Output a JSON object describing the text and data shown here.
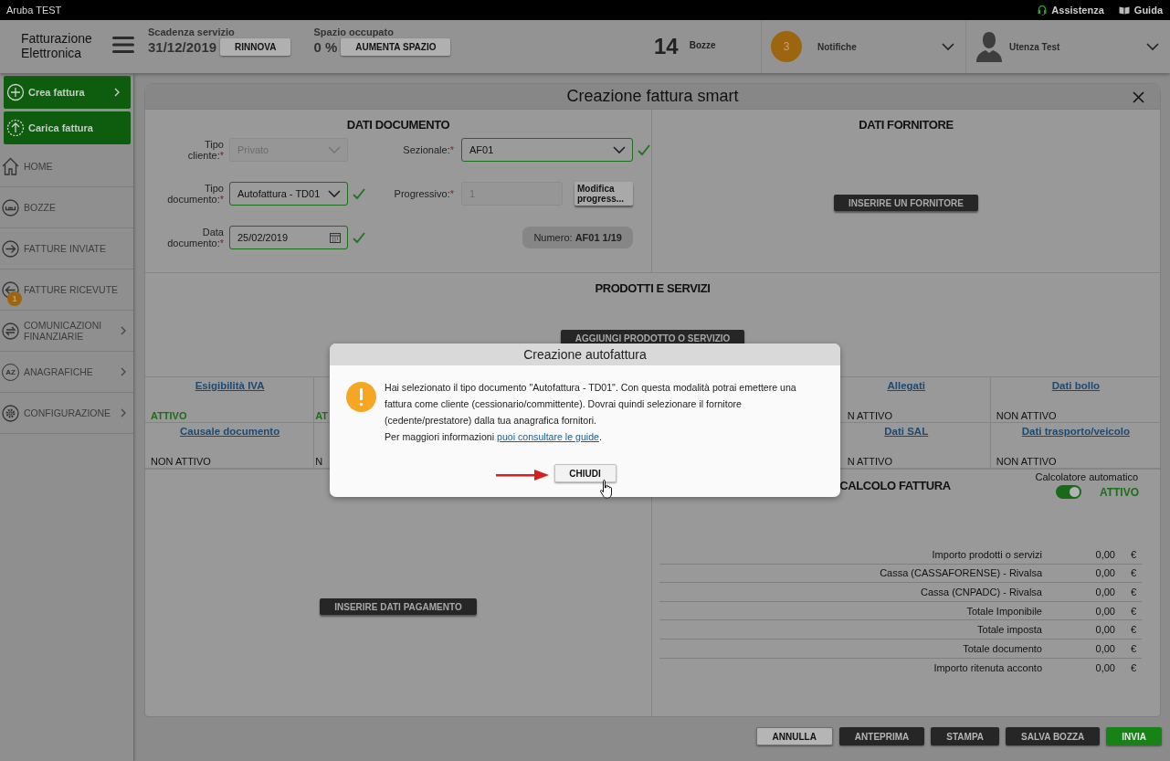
{
  "top_bar": {
    "brand": "Aruba TEST",
    "links": [
      {
        "label": "Assistenza"
      },
      {
        "label": "Guida"
      }
    ]
  },
  "header": {
    "logo": "Fatturazione Elettronica",
    "service_expiry": {
      "label": "Scadenza servizio",
      "value": "31/12/2019",
      "button": "RINNOVA"
    },
    "space": {
      "label": "Spazio occupato",
      "value": "0 %",
      "button": "AUMENTA SPAZIO"
    },
    "drafts": {
      "count": "14",
      "label": "Bozze"
    },
    "notifications": {
      "count": "3",
      "label": "Notifiche"
    },
    "user": {
      "name": "Utenza Test"
    }
  },
  "sidebar": {
    "actions": [
      {
        "label": "Crea fattura",
        "expandable": true
      },
      {
        "label": "Carica fattura",
        "expandable": false
      }
    ],
    "items": [
      {
        "label": "HOME",
        "expandable": false
      },
      {
        "label": "BOZZE",
        "expandable": false
      },
      {
        "label": "FATTURE INVIATE",
        "expandable": false
      },
      {
        "label": "FATTURE RICEVUTE",
        "expandable": false,
        "badge": "1"
      },
      {
        "label": "COMUNICAZIONI FINANZIARIE",
        "expandable": true
      },
      {
        "label": "ANAGRAFICHE",
        "expandable": true,
        "icon_text": "AZ"
      },
      {
        "label": "CONFIGURAZIONE",
        "expandable": true
      }
    ]
  },
  "panel": {
    "title": "Creazione fattura smart",
    "document": {
      "title": "DATI DOCUMENTO",
      "form_rows": [
        {
          "fields": [
            {
              "label": "Tipo cliente:",
              "required_mark": "*",
              "kind": "select",
              "value": "Privato",
              "disabled": true,
              "valid": false
            },
            {
              "label": "Sezionale:",
              "required_mark": "*",
              "kind": "select",
              "value": "AF01",
              "disabled": false,
              "valid": true
            }
          ]
        },
        {
          "fields": [
            {
              "label": "Tipo documento:",
              "required_mark": "*",
              "kind": "select",
              "value": "Autofattura - TD01",
              "disabled": false,
              "valid": true
            },
            {
              "label": "Progressivo:",
              "required_mark": "*",
              "kind": "text",
              "value": "1",
              "disabled": true,
              "valid": false
            }
          ],
          "button": "Modifica progress..."
        },
        {
          "fields": [
            {
              "label": "Data documento:",
              "required_mark": "*",
              "kind": "date",
              "value": "25/02/2019",
              "disabled": false,
              "valid": true
            }
          ],
          "number": {
            "label": "Numero:",
            "value": "AF01 1/19"
          }
        }
      ]
    },
    "supplier": {
      "title": "DATI FORNITORE",
      "button": "INSERIRE UN FORNITORE"
    },
    "products": {
      "title": "PRODOTTI E SERVIZI",
      "button": "AGGIUNGI PRODOTTO O SERVIZIO"
    },
    "options_grid": [
      {
        "left": [
          {
            "label": "Esigibilità IVA",
            "status": "ATTIVO",
            "active": true
          },
          {
            "status": "AT",
            "active": true
          }
        ],
        "right": [
          {
            "label": "Allegati",
            "status": "N ATTIVO",
            "active": false
          },
          {
            "label": "Dati bollo",
            "status": "NON ATTIVO",
            "active": false
          }
        ]
      },
      {
        "left": [
          {
            "label": "Causale documento",
            "status": "NON ATTIVO",
            "active": false
          },
          {
            "status": "N",
            "active": false
          }
        ],
        "right": [
          {
            "label": "Dati SAL",
            "status": "N ATTIVO",
            "active": false
          },
          {
            "label": "Dati trasporto/veicolo",
            "status": "NON ATTIVO",
            "active": false
          }
        ]
      }
    ],
    "payment": {
      "button": "INSERIRE DATI PAGAMENTO"
    },
    "calculation": {
      "title": "CALCOLO FATTURA",
      "auto_label": "Calcolatore automatico",
      "auto_on": true,
      "auto_status": "ATTIVO",
      "rows": [
        {
          "label": "Importo prodotti o servizi",
          "value": "0,00",
          "currency": "€"
        },
        {
          "label": "Cassa (CASSAFORENSE) - Rivalsa",
          "value": "0,00",
          "currency": "€"
        },
        {
          "label": "Cassa (CNPADC) - Rivalsa",
          "value": "0,00",
          "currency": "€"
        },
        {
          "label": "Totale Imponibile",
          "value": "0,00",
          "currency": "€"
        },
        {
          "label": "Totale imposta",
          "value": "0,00",
          "currency": "€"
        },
        {
          "label": "Totale documento",
          "value": "0,00",
          "currency": "€"
        },
        {
          "label": "Importo ritenuta acconto",
          "value": "0,00",
          "currency": "€"
        }
      ]
    }
  },
  "footer_buttons": [
    {
      "label": "ANNULLA",
      "kind": "outline"
    },
    {
      "label": "ANTEPRIMA",
      "kind": "dark"
    },
    {
      "label": "STAMPA",
      "kind": "dark"
    },
    {
      "label": "SALVA BOZZA",
      "kind": "dark"
    },
    {
      "label": "INVIA",
      "kind": "primary"
    }
  ],
  "dialog": {
    "title": "Creazione autofattura",
    "message": "Hai selezionato il tipo documento \"Autofattura - TD01\". Con questa modalità potrai emettere una fattura come cliente (cessionario/committente). Dovrai quindi selezionare il fornitore (cedente/prestatore) dalla tua anagrafica fornitori.",
    "more_info": "Per maggiori informazioni",
    "link": "puoi consultare le guide",
    "after_link": ".",
    "button": "CHIUDI"
  }
}
